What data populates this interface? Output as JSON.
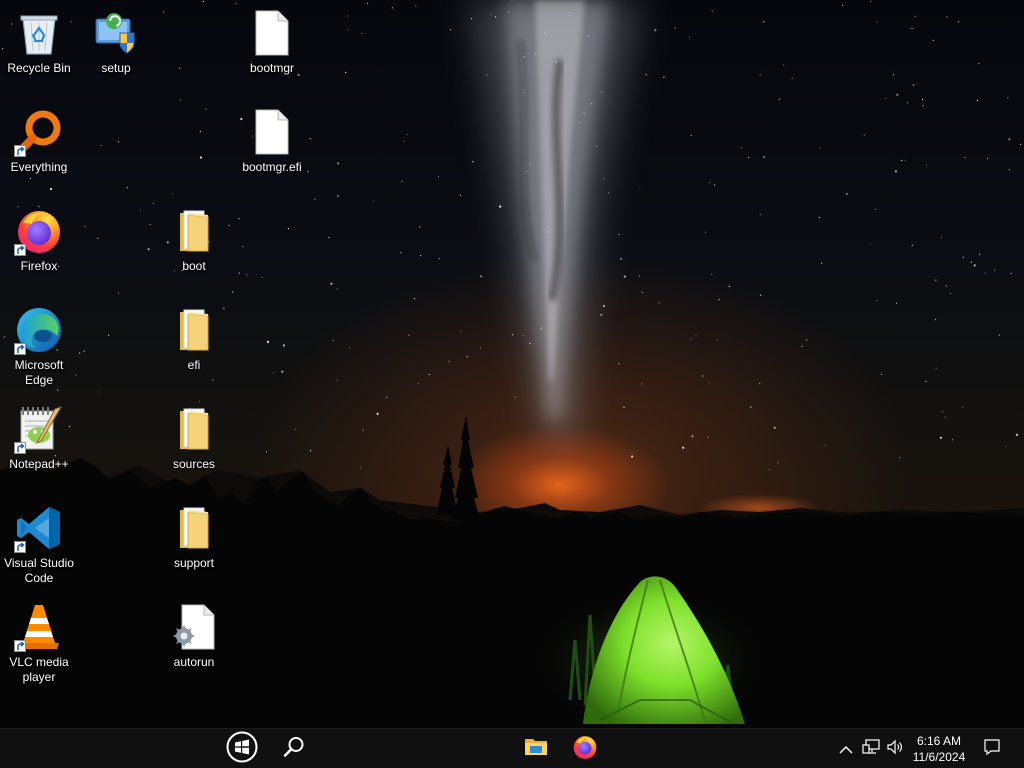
{
  "desktop": {
    "icons": [
      {
        "label": "Recycle Bin",
        "icon": "recycle-bin-icon",
        "shortcut": false
      },
      {
        "label": "setup",
        "icon": "setup-installer-icon",
        "shortcut": false
      },
      {
        "label": "bootmgr",
        "icon": "blank-file-icon",
        "shortcut": false
      },
      {
        "label": "Everything",
        "icon": "everything-search-icon",
        "shortcut": true
      },
      {
        "label": "bootmgr.efi",
        "icon": "blank-file-icon",
        "shortcut": false
      },
      {
        "label": "Firefox",
        "icon": "firefox-icon",
        "shortcut": true
      },
      {
        "label": "boot",
        "icon": "folder-icon",
        "shortcut": false
      },
      {
        "label": "Microsoft Edge",
        "icon": "edge-icon",
        "shortcut": true
      },
      {
        "label": "efi",
        "icon": "folder-icon",
        "shortcut": false
      },
      {
        "label": "Notepad++",
        "icon": "notepad-plus-plus-icon",
        "shortcut": true
      },
      {
        "label": "sources",
        "icon": "folder-icon",
        "shortcut": false
      },
      {
        "label": "Visual Studio Code",
        "icon": "vscode-icon",
        "shortcut": true
      },
      {
        "label": "support",
        "icon": "folder-icon",
        "shortcut": false
      },
      {
        "label": "VLC media player",
        "icon": "vlc-icon",
        "shortcut": true
      },
      {
        "label": "autorun",
        "icon": "autorun-settings-file-icon",
        "shortcut": false
      }
    ]
  },
  "taskbar": {
    "start_icon": "windows-start-icon",
    "search_icon": "search-icon",
    "pinned": [
      {
        "name": "File Explorer",
        "icon": "file-explorer-icon"
      },
      {
        "name": "Firefox",
        "icon": "firefox-icon"
      }
    ],
    "tray": {
      "overflow_icon": "chevron-up-icon",
      "network_icon": "network-icon",
      "volume_icon": "volume-icon",
      "time": "6:16 AM",
      "date": "11/6/2024",
      "notifications_icon": "notification-icon"
    }
  },
  "colors": {
    "taskbar_bg": "#101010",
    "tent_green": "#7ee02a",
    "glow_orange": "#ff6a1a",
    "folder_yellow": "#f4d37a"
  }
}
